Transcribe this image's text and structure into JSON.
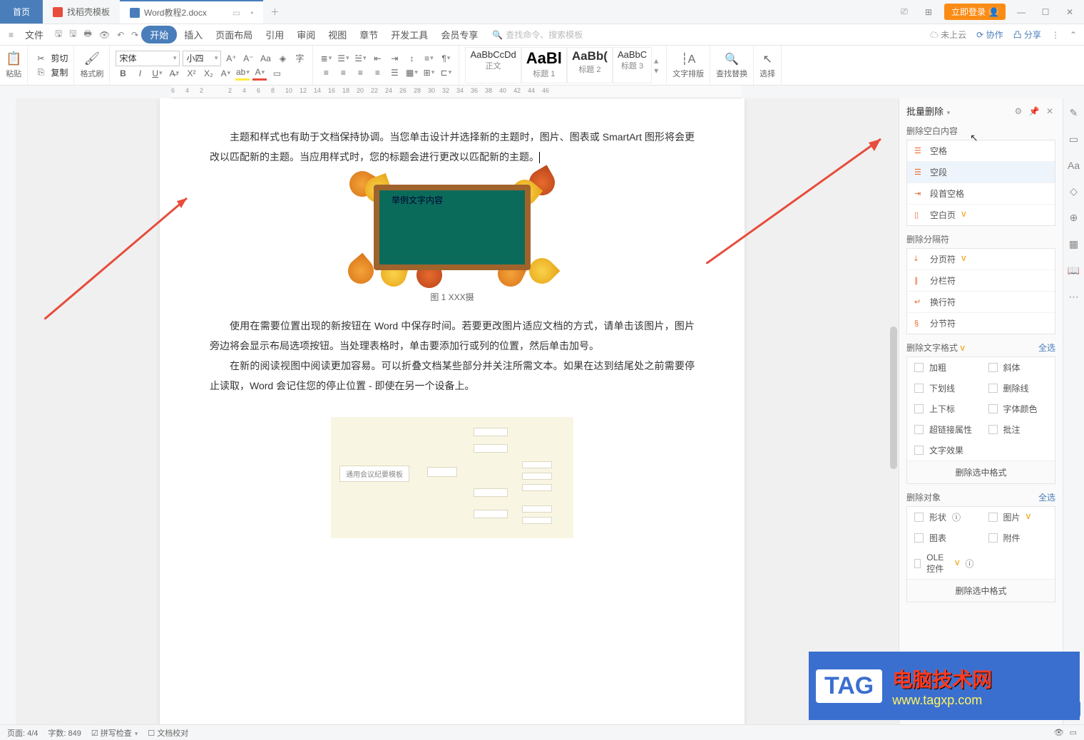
{
  "titlebar": {
    "home": "首页",
    "tab1": "找稻壳模板",
    "tab2": "Word教程2.docx",
    "login": "立即登录"
  },
  "menubar": {
    "file": "文件",
    "items": [
      "开始",
      "插入",
      "页面布局",
      "引用",
      "审阅",
      "视图",
      "章节",
      "开发工具",
      "会员专享"
    ],
    "search_placeholder": "查找命令、搜索模板",
    "cloud": "未上云",
    "coop": "协作",
    "share": "分享"
  },
  "ribbon": {
    "paste": "粘贴",
    "cut": "剪切",
    "copy": "复制",
    "brush": "格式刷",
    "font_name": "宋体",
    "font_size": "小四",
    "styles": [
      {
        "preview": "AaBbCcDd",
        "label": "正文"
      },
      {
        "preview": "AaBl",
        "label": "标题 1"
      },
      {
        "preview": "AaBb(",
        "label": "标题 2"
      },
      {
        "preview": "AaBbC",
        "label": "标题 3"
      }
    ],
    "typeset": "文字排版",
    "findreplace": "查找替换",
    "select": "选择"
  },
  "ruler": [
    "6",
    "4",
    "2",
    "2",
    "4",
    "6",
    "8",
    "10",
    "12",
    "14",
    "16",
    "18",
    "20",
    "22",
    "24",
    "26",
    "28",
    "30",
    "32",
    "34",
    "36",
    "38",
    "40",
    "42",
    "44",
    "46"
  ],
  "doc": {
    "p1": "主题和样式也有助于文档保持协调。当您单击设计并选择新的主题时，图片、图表或 SmartArt 图形将会更改以匹配新的主题。当应用样式时，您的标题会进行更改以匹配新的主题。",
    "img_text": "举例文字内容",
    "caption": "图 1  XXX摄",
    "p2": "使用在需要位置出现的新按钮在 Word 中保存时间。若要更改图片适应文档的方式，请单击该图片，图片旁边将会显示布局选项按钮。当处理表格时，单击要添加行或列的位置，然后单击加号。",
    "p3": "在新的阅读视图中阅读更加容易。可以折叠文档某些部分并关注所需文本。如果在达到结尾处之前需要停止读取，Word 会记住您的停止位置 - 即使在另一个设备上。",
    "mm_root": "通用会议纪要模板"
  },
  "panel": {
    "title": "批量删除",
    "s1": "删除空白内容",
    "s1_items": [
      "空格",
      "空段",
      "段首空格",
      "空白页"
    ],
    "s2": "删除分隔符",
    "s2_items": [
      "分页符",
      "分栏符",
      "换行符",
      "分节符"
    ],
    "s3": "删除文字格式",
    "s3_all": "全选",
    "s3_items": [
      "加粗",
      "斜体",
      "下划线",
      "删除线",
      "上下标",
      "字体颜色",
      "超链接属性",
      "批注",
      "文字效果"
    ],
    "s3_btn": "删除选中格式",
    "s4": "删除对象",
    "s4_all": "全选",
    "s4_items": [
      "形状",
      "图片",
      "图表",
      "附件",
      "OLE控件"
    ],
    "s4_btn": "删除选中格式"
  },
  "status": {
    "page": "页面: 4/4",
    "words": "字数: 849",
    "spell": "拼写检查",
    "proof": "文档校对"
  },
  "watermark": {
    "tag": "TAG",
    "line1": "电脑技术网",
    "line2": "www.tagxp.com"
  }
}
